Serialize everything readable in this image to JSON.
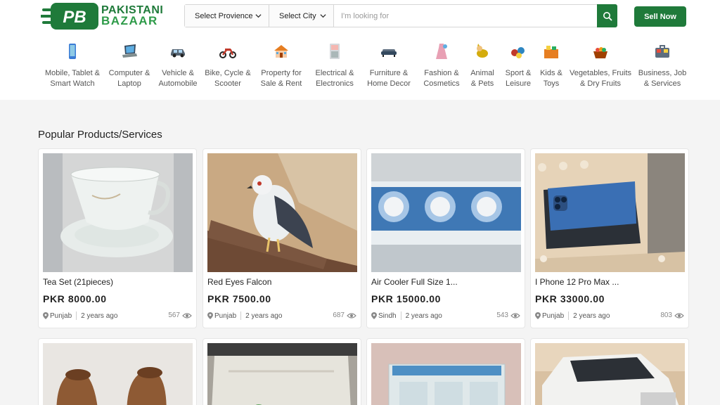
{
  "header": {
    "logo_line1": "PAKISTANI",
    "logo_line2": "BAZAAR",
    "logo_mark": "PB",
    "province_label": "Select Provience",
    "city_label": "Select City",
    "search_placeholder": "I'm looking for",
    "sell_label": "Sell Now",
    "brand_color": "#1f7a3a"
  },
  "categories": [
    {
      "label": "Mobile, Tablet &\nSmart Watch",
      "icon": "mobile-icon"
    },
    {
      "label": "Computer &\nLaptop",
      "icon": "laptop-icon"
    },
    {
      "label": "Vehicle &\nAutomobile",
      "icon": "car-icon"
    },
    {
      "label": "Bike, Cycle &\nScooter",
      "icon": "bike-icon"
    },
    {
      "label": "Property for\nSale & Rent",
      "icon": "house-icon"
    },
    {
      "label": "Electrical &\nElectronics",
      "icon": "appliance-icon"
    },
    {
      "label": "Furniture &\nHome Decor",
      "icon": "sofa-icon"
    },
    {
      "label": "Fashion &\nCosmetics",
      "icon": "dress-icon"
    },
    {
      "label": "Animal\n& Pets",
      "icon": "pet-icon"
    },
    {
      "label": "Sport &\nLeisure",
      "icon": "sports-icon"
    },
    {
      "label": "Kids &\nToys",
      "icon": "toys-icon"
    },
    {
      "label": "Vegetables, Fruits\n& Dry Fruits",
      "icon": "fruit-basket-icon"
    },
    {
      "label": "Business, Job\n& Services",
      "icon": "briefcase-icon"
    }
  ],
  "section_title": "Popular Products/Services",
  "products": [
    {
      "title": "Tea Set (21pieces)",
      "price": "PKR  8000.00",
      "location": "Punjab",
      "age": "2 years ago",
      "views": "567"
    },
    {
      "title": "Red Eyes Falcon",
      "price": "PKR  7500.00",
      "location": "Punjab",
      "age": "2 years ago",
      "views": "687"
    },
    {
      "title": "Air Cooler Full Size 1...",
      "price": "PKR  15000.00",
      "location": "Sindh",
      "age": "2 years ago",
      "views": "543"
    },
    {
      "title": "I Phone 12 Pro Max ...",
      "price": "PKR  33000.00",
      "location": "Punjab",
      "age": "2 years ago",
      "views": "803"
    }
  ]
}
